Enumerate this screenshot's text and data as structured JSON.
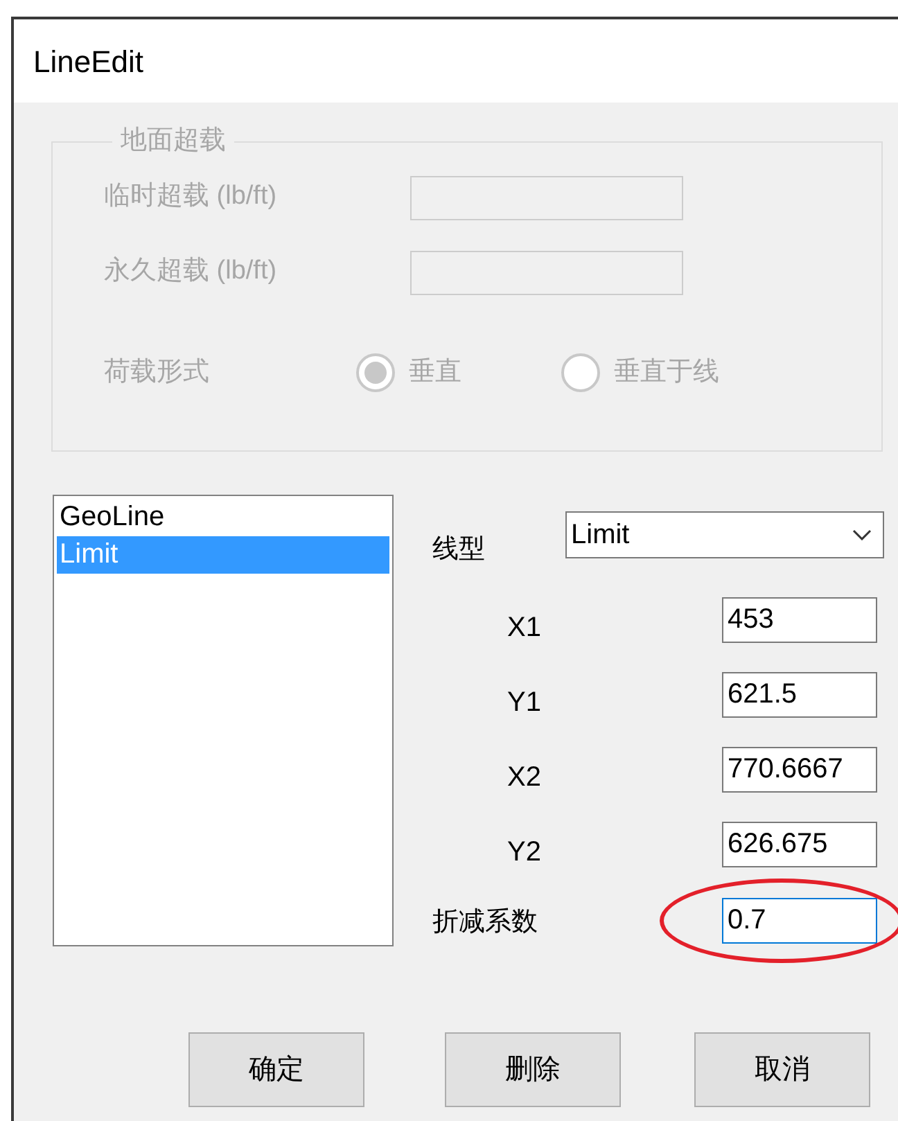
{
  "window": {
    "title": "LineEdit"
  },
  "surcharge_group": {
    "title": "地面超载",
    "disabled": true,
    "fields": [
      {
        "label": "临时超载 (lb/ft)"
      },
      {
        "label": "永久超载 (lb/ft)"
      }
    ],
    "load_type": {
      "label": "荷载形式",
      "options": [
        {
          "label": "垂直",
          "selected": true
        },
        {
          "label": "垂直于线",
          "selected": false
        }
      ]
    }
  },
  "line_list": {
    "items": [
      {
        "label": "GeoLine",
        "selected": false
      },
      {
        "label": "Limit",
        "selected": true
      }
    ]
  },
  "line_type": {
    "label": "线型",
    "value": "Limit"
  },
  "coordinates": [
    {
      "label": "X1",
      "value": "453"
    },
    {
      "label": "Y1",
      "value": "621.5"
    },
    {
      "label": "X2",
      "value": "770.6667"
    },
    {
      "label": "Y2",
      "value": "626.675"
    }
  ],
  "reduction_factor": {
    "label": "折减系数",
    "value": "0.7",
    "focused": true,
    "circled": true
  },
  "buttons": [
    {
      "label": "确定"
    },
    {
      "label": "删除"
    },
    {
      "label": "取消"
    }
  ]
}
